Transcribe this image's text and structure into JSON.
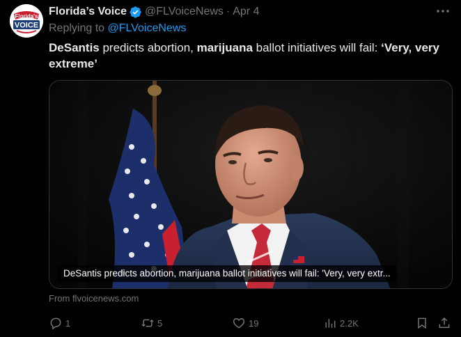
{
  "author": {
    "display_name": "Florida’s Voice",
    "handle": "@FLVoiceNews",
    "separator": "·",
    "date": "Apr 4",
    "avatar_logo_text": [
      "Florida's",
      "VOICE"
    ]
  },
  "reply": {
    "prefix": "Replying to",
    "mention": "@FLVoiceNews"
  },
  "tweet": {
    "text_parts": [
      {
        "text": "DeSantis",
        "bold": true
      },
      {
        "text": " predicts abortion, ",
        "bold": false
      },
      {
        "text": "marijuana",
        "bold": true
      },
      {
        "text": " ballot initiatives will fail: ",
        "bold": false
      },
      {
        "text": "‘Very, very extreme’",
        "bold": true
      }
    ]
  },
  "card": {
    "caption": "DeSantis predicts abortion, marijuana ballot initiatives will fail: 'Very, very extr...",
    "source": "From flvoicenews.com"
  },
  "actions": {
    "reply_count": "1",
    "retweet_count": "5",
    "like_count": "19",
    "views_count": "2.2K"
  },
  "colors": {
    "background": "#000000",
    "text": "#e7e9ea",
    "muted": "#71767b",
    "link": "#1d9bf0",
    "verified": "#1d9bf0"
  }
}
